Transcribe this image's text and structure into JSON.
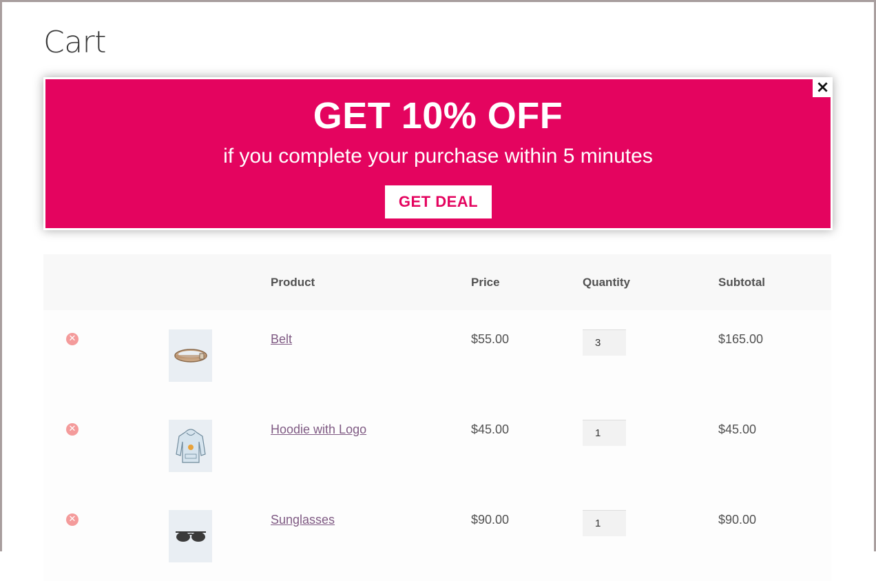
{
  "page": {
    "title": "Cart"
  },
  "promo": {
    "headline": "GET 10% OFF",
    "subtext": "if you complete your purchase within 5 minutes",
    "button_label": "GET DEAL",
    "close_label": "×",
    "bg_color": "#e4045f"
  },
  "table": {
    "headers": [
      "Product",
      "Price",
      "Quantity",
      "Subtotal"
    ],
    "rows": [
      {
        "product": "Belt",
        "price": "$55.00",
        "quantity": "3",
        "subtotal": "$165.00",
        "thumb_icon": "belt-icon"
      },
      {
        "product": "Hoodie with Logo",
        "price": "$45.00",
        "quantity": "1",
        "subtotal": "$45.00",
        "thumb_icon": "hoodie-icon"
      },
      {
        "product": "Sunglasses",
        "price": "$90.00",
        "quantity": "1",
        "subtotal": "$90.00",
        "thumb_icon": "sunglasses-icon"
      }
    ],
    "remove_icon": "remove-circle-icon"
  }
}
